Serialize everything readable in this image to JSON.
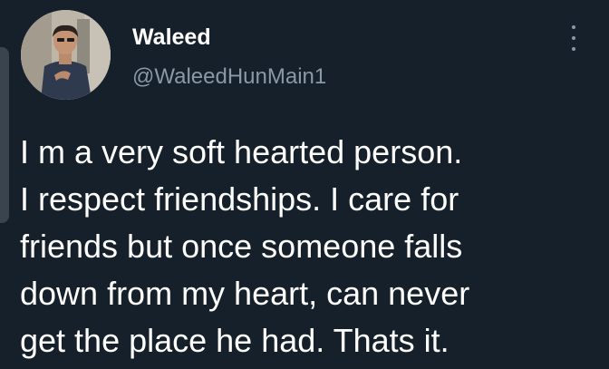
{
  "tweet": {
    "author": {
      "display_name": "Waleed",
      "handle": "@WaleedHunMain1",
      "avatar_icon": "profile-photo"
    },
    "more_icon": "more-vertical-icon",
    "text_lines": [
      "I m a very soft hearted person.",
      "I respect friendships. I care for",
      "friends but once someone falls",
      "down from my heart, can never",
      "get the place he had. Thats it."
    ]
  },
  "colors": {
    "background": "#15202b",
    "primary_text": "#ffffff",
    "secondary_text": "#8b98a5"
  }
}
